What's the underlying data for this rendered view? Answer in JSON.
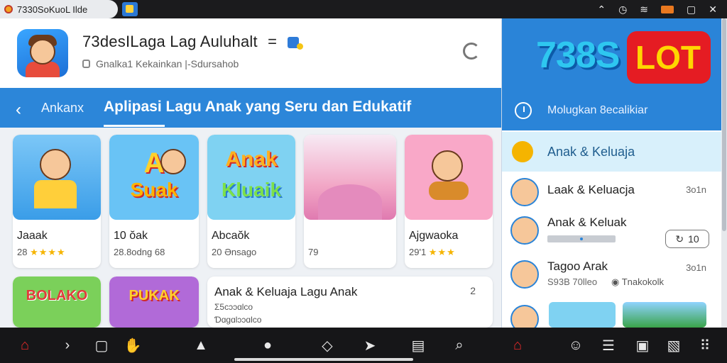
{
  "status_bar": {
    "tab_title": "7330SoKuoL Ilde",
    "icons": [
      "chevron-up-icon",
      "alarm-icon",
      "wifi-icon",
      "battery-icon",
      "window-icon",
      "close-icon"
    ]
  },
  "app_header": {
    "title": "73desILaga Lag Auluhalt",
    "title_suffix": "=",
    "subtitle": "Gnalka1 Kekainkan  |-Sdursahob",
    "icons": [
      "app-logo-icon",
      "lock-icon",
      "refresh-icon"
    ]
  },
  "nav_bar": {
    "back_label": "Ankanx",
    "page_title": "Aplipasi Lagu Anak yang Seru dan Edukatif"
  },
  "cards": [
    {
      "name": "Jaaak",
      "meta": "28",
      "stars": "★★★★",
      "thumb_color": "#5ab3f0"
    },
    {
      "name": "10 ŏak",
      "meta": "28.8odng 68",
      "stars": "",
      "thumb_color": "#69c3f5",
      "thumb_text": "A Suak"
    },
    {
      "name": "Abcaŏk",
      "meta": "20 Ənsago",
      "stars": "",
      "thumb_color": "#7fd2f2",
      "thumb_text": "Anak Kluaik"
    },
    {
      "name": "",
      "meta": "79",
      "stars": "",
      "thumb_color": "#f2a7c6"
    },
    {
      "name": "Ajgwaoka",
      "meta": "29'1",
      "stars": "★★★",
      "thumb_color": "#f9a8c8"
    },
    {
      "name": "",
      "meta": "",
      "stars": "",
      "thumb_color": "#7bd05a",
      "thumb_text": "BOLAKO"
    },
    {
      "name": "",
      "meta": "",
      "stars": "",
      "thumb_color": "#b16ad8",
      "thumb_text": "PUKAK"
    }
  ],
  "featured_card": {
    "title": "Anak & Keluaja Lagu Anak",
    "count": "2",
    "line1": "Ʃ5cɔɔɑlco",
    "line2": "Ɗɑgɑlɔɔɑlco"
  },
  "right_panel": {
    "brand_number": "738S",
    "brand_lot": "LOT",
    "clock_label": "Molugkan 8ecalikiar",
    "selected_label": "Anak & Keluaja",
    "items": [
      {
        "title": "Laak & Keluacja",
        "sub": "",
        "right": "3o1n"
      },
      {
        "title": "Anak & Keluak",
        "sub": "",
        "right": "10"
      },
      {
        "title": "Tagoo Arak",
        "sub": "S93B 70lleo",
        "right": "3o1n",
        "extra": "Tnakokolk"
      }
    ]
  },
  "bottom_nav": {
    "icons": [
      "home-icon",
      "forward-icon",
      "square-icon",
      "hand-icon",
      "bell-icon",
      "pin-icon",
      "diamond-icon",
      "cursor-icon",
      "clipboard-icon",
      "search-icon",
      "house-icon",
      "user-icon",
      "tray-icon",
      "frame-icon",
      "image-icon",
      "grid-icon"
    ]
  }
}
